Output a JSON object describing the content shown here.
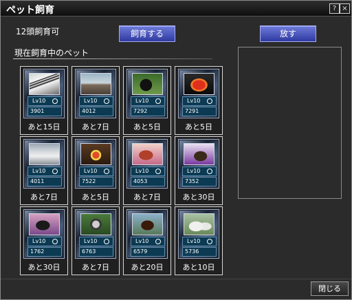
{
  "window": {
    "title": "ペット飼育",
    "help_label": "?",
    "close_label": "×"
  },
  "capacity_text": "12頭飼育可",
  "buttons": {
    "raise": "飼育する",
    "release": "放す",
    "close": "閉じる"
  },
  "section_label": "現在飼育中のペット",
  "pets": [
    {
      "level": "Lv10",
      "number": "3901",
      "days": "あと15日",
      "image": "zebra-image"
    },
    {
      "level": "Lv10",
      "number": "4012",
      "days": "あと7日",
      "image": "reindeer-image"
    },
    {
      "level": "Lv10",
      "number": "7292",
      "days": "あと5日",
      "image": "black-dog-image"
    },
    {
      "level": "Lv10",
      "number": "7291",
      "days": "あと5日",
      "image": "goldfish-image"
    },
    {
      "level": "Lv10",
      "number": "4011",
      "days": "あと7日",
      "image": "white-reindeer-image"
    },
    {
      "level": "Lv10",
      "number": "7522",
      "days": "あと5日",
      "image": "bird-image"
    },
    {
      "level": "Lv10",
      "number": "4053",
      "days": "あと7日",
      "image": "red-horse-image"
    },
    {
      "level": "Lv10",
      "number": "7352",
      "days": "あと30日",
      "image": "purple-horse-image"
    },
    {
      "level": "Lv10",
      "number": "1762",
      "days": "あと30日",
      "image": "dark-horse-image"
    },
    {
      "level": "Lv10",
      "number": "6763",
      "days": "あと7日",
      "image": "raccoon-image"
    },
    {
      "level": "Lv10",
      "number": "6579",
      "days": "あと20日",
      "image": "beetle-image"
    },
    {
      "level": "Lv10",
      "number": "5736",
      "days": "あと10日",
      "image": "sheep-image"
    }
  ],
  "colors": {
    "button_accent": "#3b46b4",
    "slot_bg": "#0c3a52"
  }
}
